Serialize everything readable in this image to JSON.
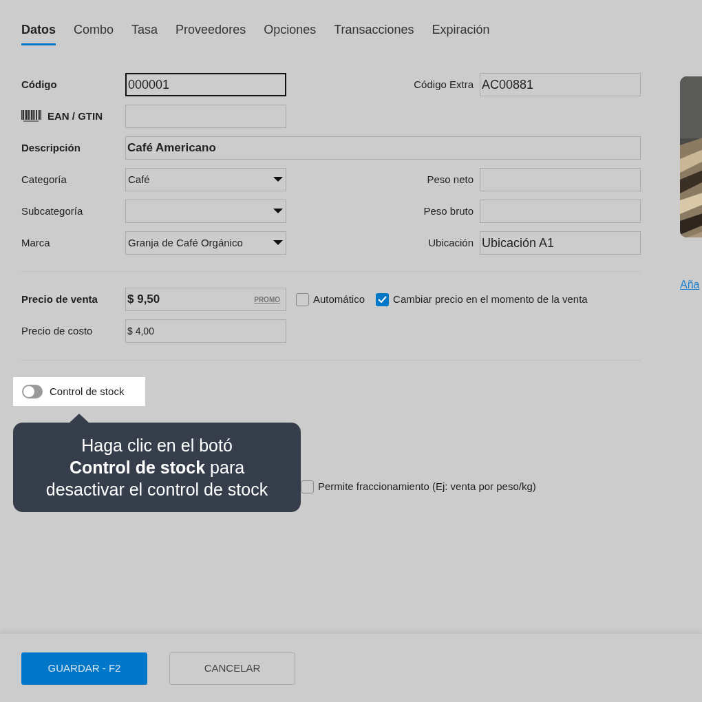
{
  "tabs": [
    {
      "label": "Datos",
      "selected": true
    },
    {
      "label": "Combo",
      "selected": false
    },
    {
      "label": "Tasa",
      "selected": false
    },
    {
      "label": "Proveedores",
      "selected": false
    },
    {
      "label": "Opciones",
      "selected": false
    },
    {
      "label": "Transacciones",
      "selected": false
    },
    {
      "label": "Expiración",
      "selected": false
    }
  ],
  "rows": [
    {
      "left": {
        "label": "Código",
        "bold": true,
        "kind": "text",
        "value": "000001",
        "focused": true
      },
      "right": {
        "label": "Código Extra",
        "kind": "text",
        "value": "AC00881"
      }
    },
    {
      "left": {
        "label": "EAN / GTIN",
        "bold": true,
        "kind": "text"
      }
    },
    {
      "wide": {
        "label": "Descripción",
        "bold": true,
        "kind": "text",
        "value": "Café Americano"
      }
    },
    {
      "left": {
        "label": "Categoría",
        "bold": false,
        "kind": "select",
        "value": "Café"
      },
      "right": {
        "label": "Peso neto",
        "kind": "text"
      }
    },
    {
      "left": {
        "label": "Subcategoría",
        "bold": false,
        "kind": "select"
      },
      "right": {
        "label": "Peso bruto",
        "kind": "text"
      }
    },
    {
      "left": {
        "label": "Marca",
        "bold": false,
        "kind": "select",
        "value": "Granja de Café Orgánico"
      },
      "right": {
        "label": "Ubicación",
        "kind": "text",
        "value": "Ubicación A1"
      }
    }
  ],
  "prices": [
    {
      "label": "Precio de venta",
      "bold": true,
      "value": "$ 9,50",
      "link": "PROMO",
      "checkboxes": [
        {
          "label": "Automático",
          "checked": false
        },
        {
          "label": "Cambiar precio en el momento de la venta",
          "checked": true
        }
      ]
    },
    {
      "label": "Precio de costo",
      "bold": false,
      "value": "$ 4,00"
    }
  ],
  "stock": {
    "toggle": {
      "label": "Control de stock",
      "on": false
    },
    "fraction": {
      "label": "Permite fraccionamiento (Ej: venta por peso/kg)",
      "checked": false
    }
  },
  "tooltip": {
    "text": "Haga clic en el botó\n**Control de stock** para\ndesactivar el control de stock"
  },
  "image": {
    "kind": "picture",
    "link": "Aña"
  },
  "buttons": [
    {
      "label": "GUARDAR - F2",
      "kind": "primary"
    },
    {
      "label": "CANCELAR",
      "kind": "secondary"
    }
  ]
}
